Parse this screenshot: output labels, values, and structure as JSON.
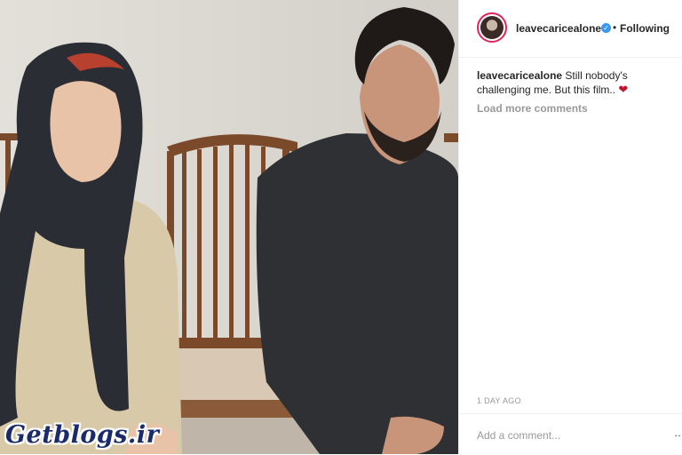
{
  "post": {
    "username": "leavecaricealone",
    "verified_icon": "verified-badge-icon",
    "separator": "•",
    "follow_label": "Following",
    "caption_username": "leavecaricealone",
    "caption_text": " Still nobody's challenging me. But this film.. ",
    "caption_emoji": "❤",
    "load_more": "Load more comments",
    "timestamp": "1 DAY AGO",
    "comment_placeholder": "Add a comment...",
    "more_options": "…"
  },
  "photo": {
    "watermark": "Getblogs.ir"
  },
  "colors": {
    "accent": "#3897f0",
    "story_ring": "#e2245b",
    "heart": "#c0152c"
  }
}
